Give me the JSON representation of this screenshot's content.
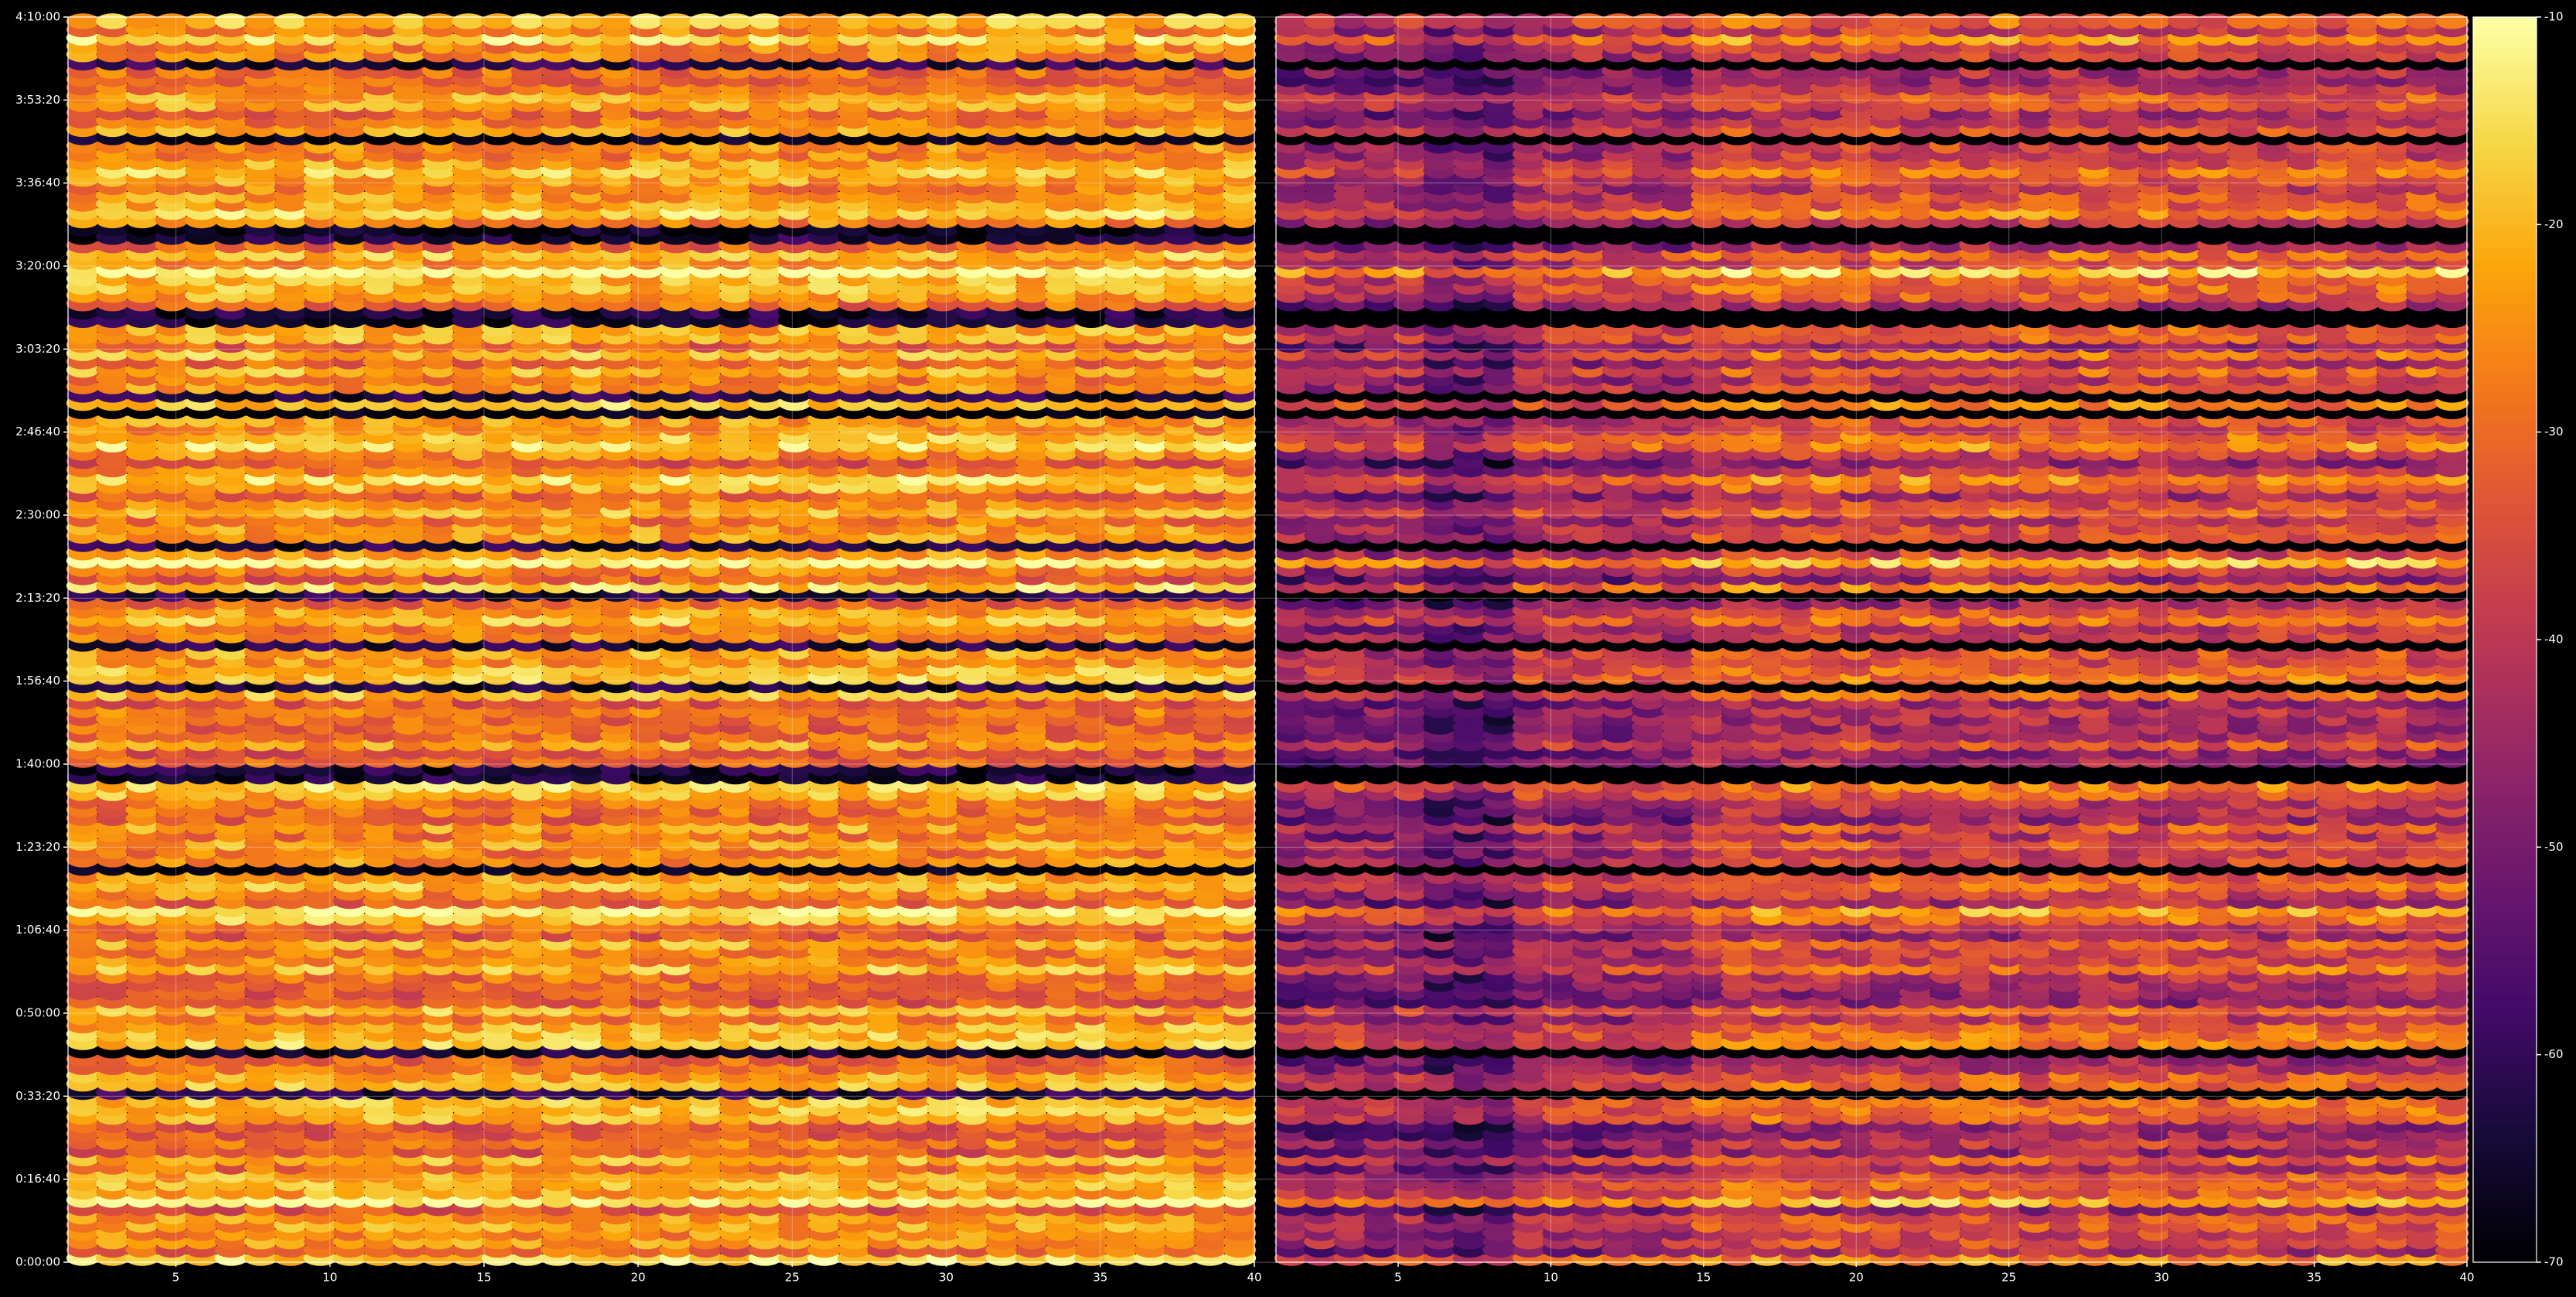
{
  "chart_data": {
    "type": "heatmap",
    "title": "",
    "panels": [
      {
        "name": "",
        "xlabel": "",
        "xlim": [
          1.5,
          40
        ],
        "xticks": [
          5,
          10,
          15,
          20,
          25,
          30,
          35,
          40
        ],
        "xtick_labels": [
          "5",
          "10",
          "15",
          "20",
          "25",
          "30",
          "35",
          "40"
        ],
        "level": "high"
      },
      {
        "name": "",
        "xlabel": "",
        "xlim": [
          1,
          40
        ],
        "xticks": [
          5,
          10,
          15,
          20,
          25,
          30,
          35,
          40
        ],
        "xtick_labels": [
          "5",
          "10",
          "15",
          "20",
          "25",
          "30",
          "35",
          "40"
        ],
        "level": "low"
      }
    ],
    "ylabel": "",
    "ylim_seconds": [
      0,
      15000
    ],
    "yticks": [
      "0:00:00",
      "0:16:40",
      "0:33:20",
      "0:50:00",
      "1:06:40",
      "1:23:20",
      "1:40:00",
      "1:56:40",
      "2:13:20",
      "2:30:00",
      "2:46:40",
      "3:03:20",
      "3:20:00",
      "3:36:40",
      "3:53:20",
      "4:10:00"
    ],
    "colorbar": {
      "colormap": "inferno",
      "vmin": -70,
      "vmax": -10,
      "ticks": [
        -10,
        -20,
        -30,
        -40,
        -50,
        -60,
        -70
      ],
      "tick_labels": [
        "-10",
        "-20",
        "-30",
        "-40",
        "-50",
        "-60",
        "-70"
      ]
    },
    "grid": true,
    "cell_columns": 40,
    "rows_estimated": 150,
    "legend": "none"
  },
  "colors": {
    "background": "#000000",
    "text": "#ffffff",
    "grid": "#ffffff"
  }
}
